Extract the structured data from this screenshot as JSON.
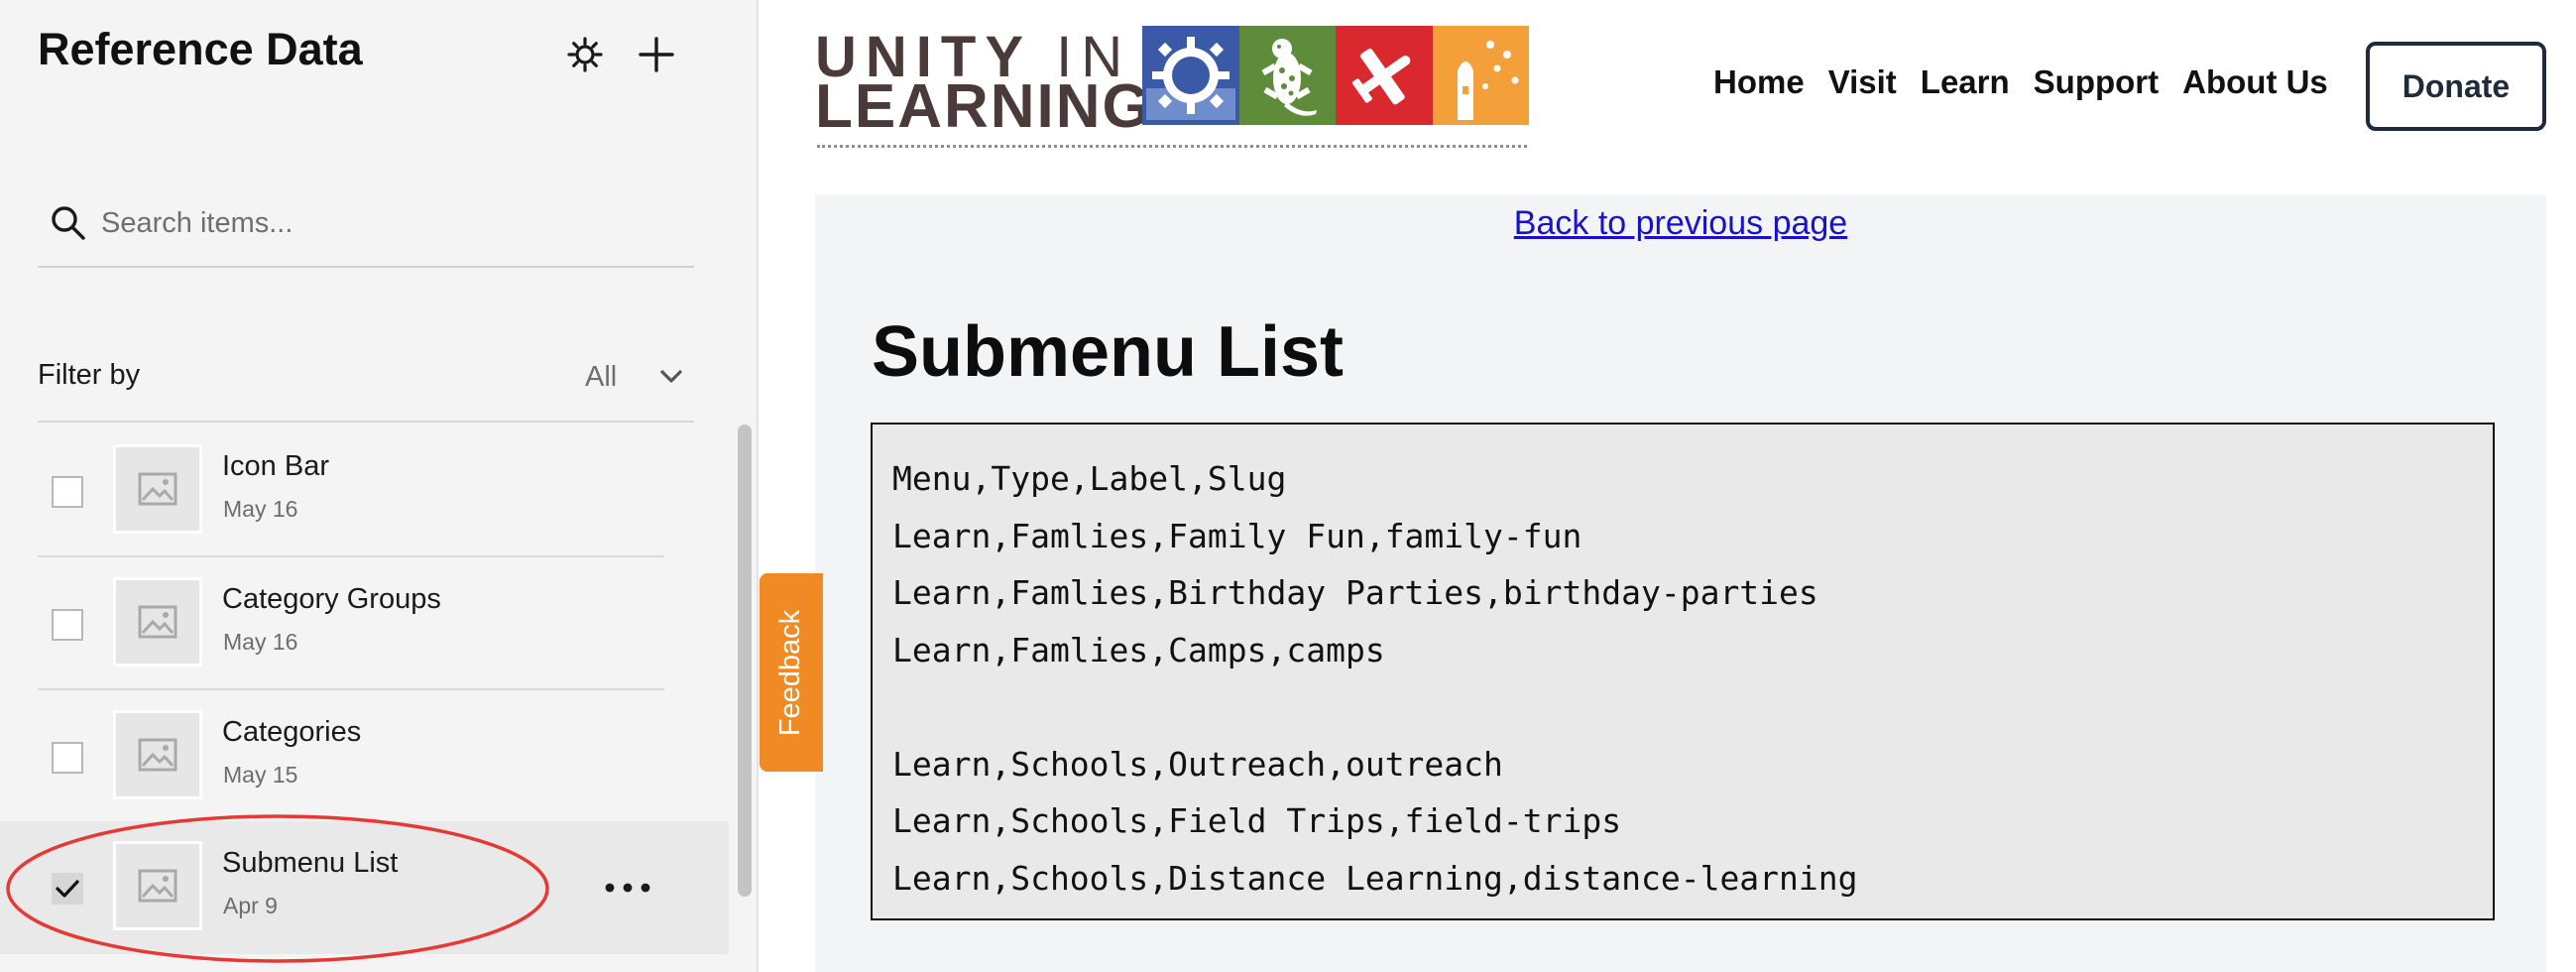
{
  "sidebar": {
    "title": "Reference Data",
    "search": {
      "placeholder": "Search items...",
      "value": ""
    },
    "filter": {
      "label": "Filter by",
      "value": "All"
    },
    "items": [
      {
        "name": "Icon Bar",
        "date": "May 16",
        "checked": false
      },
      {
        "name": "Category Groups",
        "date": "May 16",
        "checked": false
      },
      {
        "name": "Categories",
        "date": "May 15",
        "checked": false
      },
      {
        "name": "Submenu List",
        "date": "Apr 9",
        "checked": true
      }
    ],
    "highlight_color": "#e53935"
  },
  "site": {
    "logo": {
      "line1_bold": "UNITY",
      "line1_thin": "IN",
      "line2": "LEARNING"
    },
    "nav": [
      "Home",
      "Visit",
      "Learn",
      "Support",
      "About Us"
    ],
    "donate_label": "Donate",
    "back_link": "Back to previous page",
    "page_title": "Submenu List",
    "code_lines": [
      "Menu,Type,Label,Slug",
      "Learn,Famlies,Family Fun,family-fun",
      "Learn,Famlies,Birthday Parties,birthday-parties",
      "Learn,Famlies,Camps,camps",
      "",
      "Learn,Schools,Outreach,outreach",
      "Learn,Schools,Field Trips,field-trips",
      "Learn,Schools,Distance Learning,distance-learning"
    ],
    "feedback_label": "Feedback",
    "colors": {
      "logo_text": "#4a3a3a",
      "tile_blue": "#3a5aa8",
      "tile_green": "#5e8c3a",
      "tile_red": "#d9292f",
      "tile_orange": "#f3a03a",
      "feedback": "#f08a24",
      "link": "#1a12c8"
    }
  }
}
